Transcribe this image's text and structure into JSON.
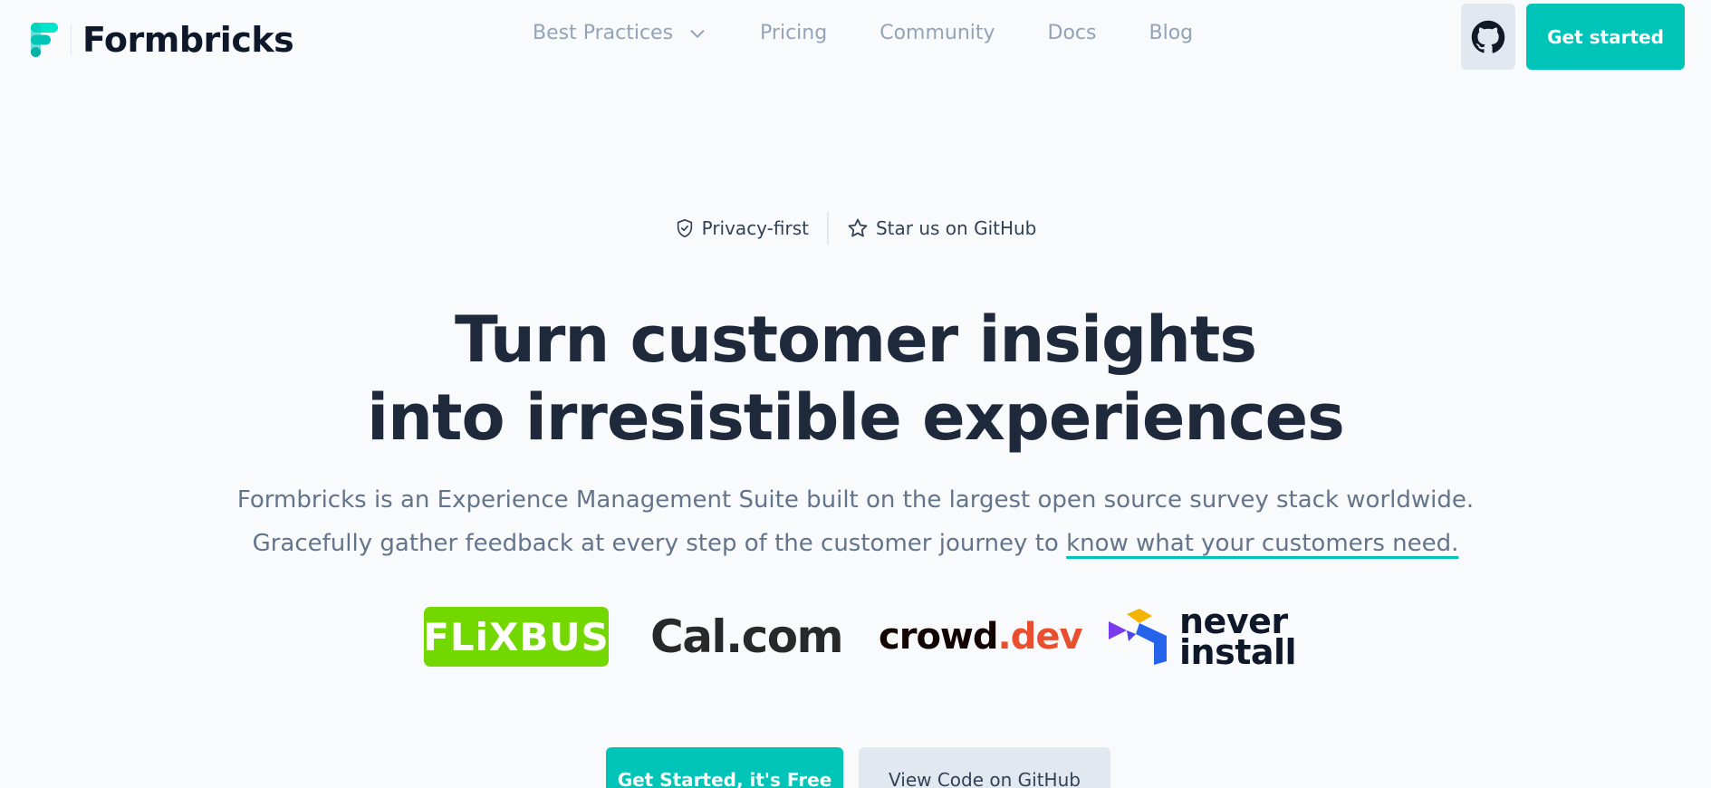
{
  "header": {
    "brand_name": "Formbricks",
    "brand_color": "#00c4b8",
    "nav": [
      {
        "label": "Best Practices",
        "has_dropdown": true
      },
      {
        "label": "Pricing"
      },
      {
        "label": "Community"
      },
      {
        "label": "Docs"
      },
      {
        "label": "Blog"
      }
    ],
    "github_icon": "github-icon",
    "cta_label": "Get started"
  },
  "badges": {
    "privacy": "Privacy-first",
    "star": "Star us on GitHub"
  },
  "hero": {
    "title_line1": "Turn customer insights",
    "title_line2": "into irresistible experiences",
    "sub_line1": "Formbricks is an Experience Management Suite built on the largest open source survey stack worldwide.",
    "sub_line2_pre": "Gracefully gather feedback at every step of the customer journey to ",
    "sub_line2_highlight": "know what your customers need."
  },
  "logos": {
    "flixbus": "FLiXBUS",
    "calcom": "Cal.com",
    "crowd_a": "crowd",
    "crowd_b": ".dev",
    "never_line1": "never",
    "never_line2": "install"
  },
  "actions": {
    "primary": "Get Started, it's Free",
    "secondary": "View Code on GitHub"
  }
}
